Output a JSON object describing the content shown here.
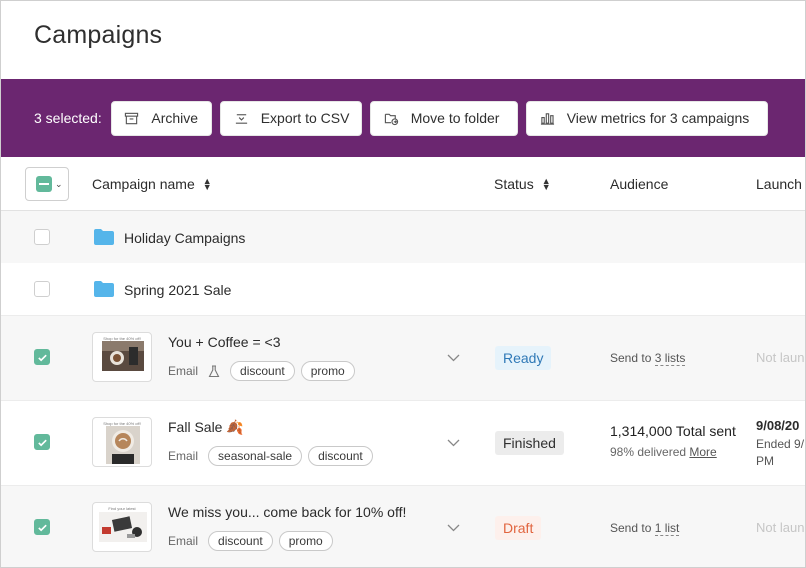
{
  "page": {
    "title": "Campaigns"
  },
  "bulk_bar": {
    "selected_label": "3 selected:",
    "buttons": {
      "archive": "Archive",
      "export": "Export to CSV",
      "move": "Move to folder",
      "metrics": "View metrics for 3 campaigns"
    }
  },
  "table": {
    "columns": {
      "name": "Campaign name",
      "status": "Status",
      "audience": "Audience",
      "launch": "Launch"
    },
    "folders": [
      {
        "name": "Holiday Campaigns",
        "checked": false
      },
      {
        "name": "Spring 2021 Sale",
        "checked": false
      }
    ],
    "campaigns": [
      {
        "name": "You + Coffee = <3",
        "channel": "Email",
        "tags": [
          "discount",
          "promo"
        ],
        "status": "Ready",
        "audience_prefix": "Send to ",
        "audience_link": "3 lists",
        "launch": "Not laun",
        "thumb_caption": "Shop for the 40% off!",
        "checked": true
      },
      {
        "name": "Fall Sale 🍂",
        "channel": "Email",
        "tags": [
          "seasonal-sale",
          "discount"
        ],
        "status": "Finished",
        "audience_total": "1,314,000 Total sent",
        "audience_delivered": "98% delivered ",
        "audience_more": "More",
        "launch_date": "9/08/20",
        "launch_ended": "Ended 9/",
        "launch_pm": "PM",
        "thumb_caption": "Shop for the 40% off!",
        "checked": true
      },
      {
        "name": "We miss you... come back for 10% off!",
        "channel": "Email",
        "tags": [
          "discount",
          "promo"
        ],
        "status": "Draft",
        "audience_prefix": "Send to ",
        "audience_link": "1 list",
        "launch": "Not laun",
        "thumb_caption": "Find your latest",
        "checked": true
      }
    ]
  },
  "colors": {
    "bulk_bar": "#6b2670",
    "check": "#62b99b",
    "ready": "#2f79b7",
    "draft": "#e1653f"
  }
}
